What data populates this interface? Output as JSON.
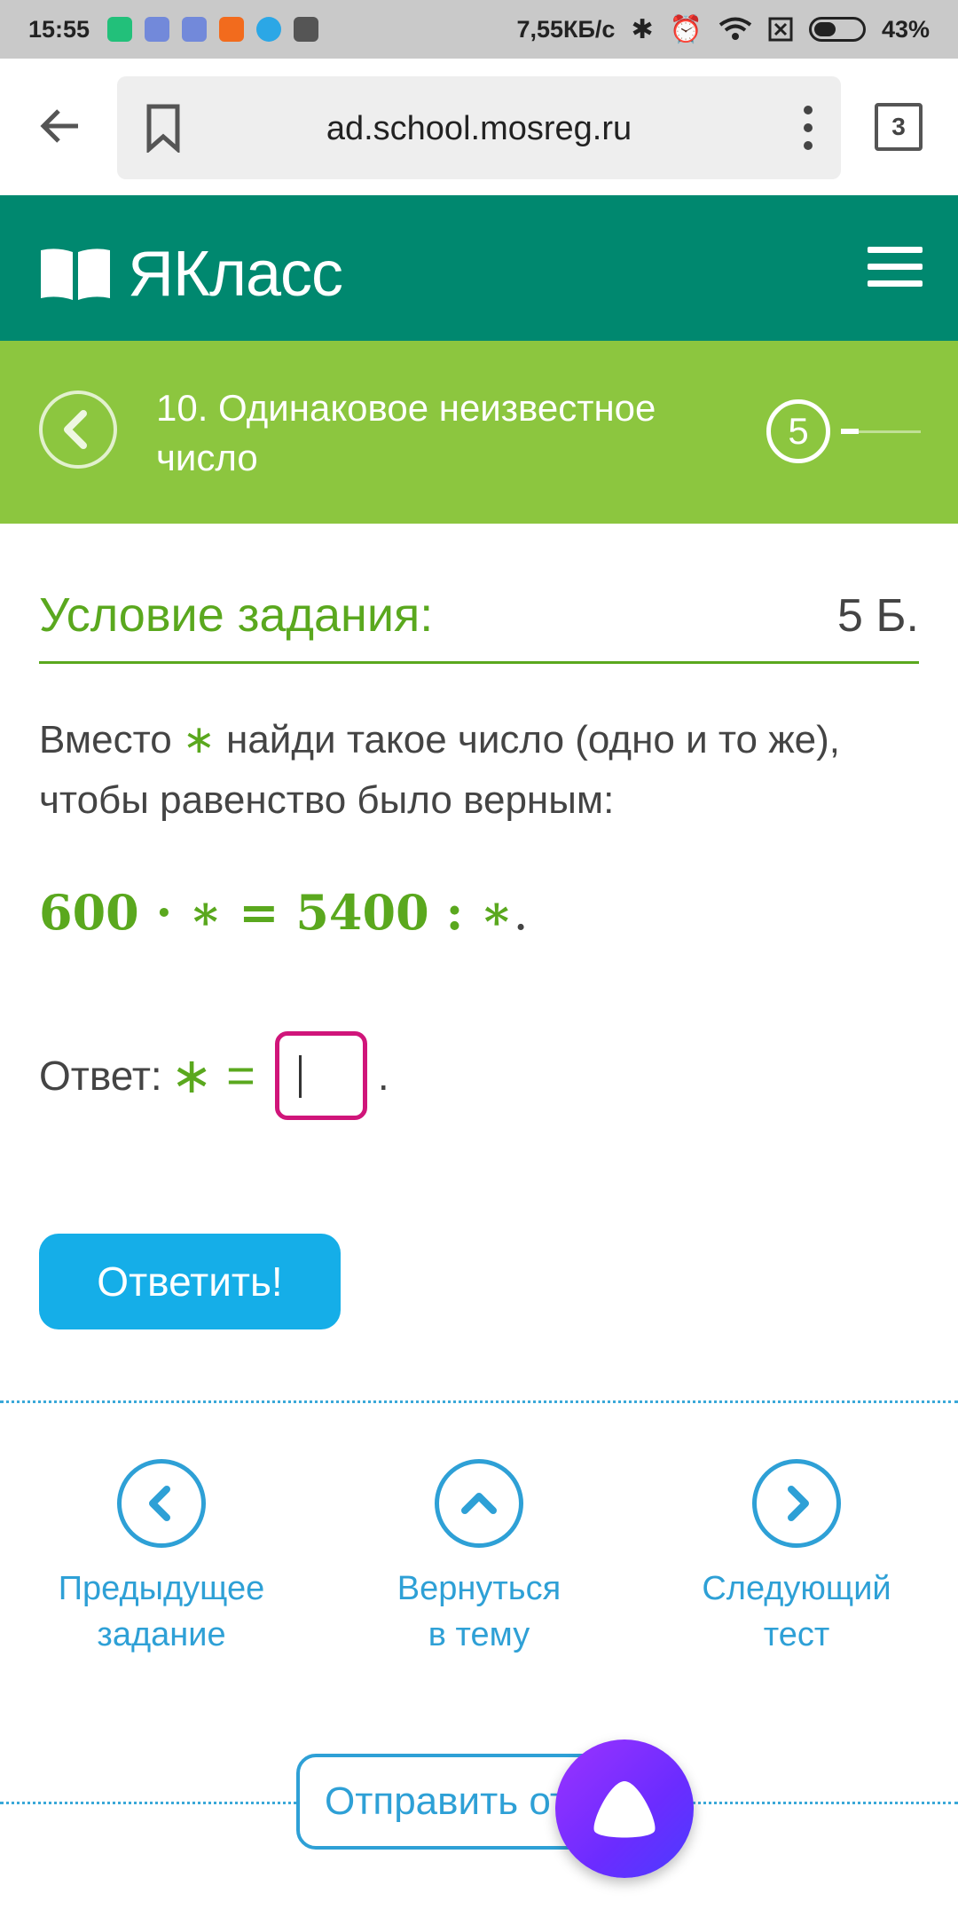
{
  "status_bar": {
    "time": "15:55",
    "network_speed": "7,55КБ/с",
    "battery": "43%",
    "battery_level": 0.43
  },
  "browser": {
    "url": "ad.school.mosreg.ru",
    "tab_count": "3"
  },
  "header": {
    "logo_text": "ЯКласс"
  },
  "topic": {
    "title": "10. Одинаковое неизвестное число",
    "step": "5"
  },
  "task": {
    "heading": "Условие задания:",
    "points": "5 Б.",
    "text_before": "Вместо ",
    "star": "∗",
    "text_after": " найди такое число (одно и то же), чтобы равенство было верным:",
    "equation": {
      "left": "600",
      "op1": "·",
      "star1": "∗",
      "eq": "=",
      "right": "5400",
      "op2": ":",
      "star2": "∗",
      "end": "."
    },
    "answer_label": "Ответ:",
    "answer_symbol": "∗ =",
    "answer_value": "",
    "answer_period": "."
  },
  "actions": {
    "submit_label": "Ответить!",
    "send_label": "Отправить от"
  },
  "nav": {
    "prev_line1": "Предыдущее",
    "prev_line2": "задание",
    "back_line1": "Вернуться",
    "back_line2": "в тему",
    "next_line1": "Следующий",
    "next_line2": "тест"
  },
  "colors": {
    "teal": "#00886f",
    "green_bar": "#8cc63f",
    "green_text": "#5aa81e",
    "blue": "#15aee8",
    "input_border": "#d0157a"
  },
  "icons": [
    "back-arrow-icon",
    "bookmark-icon",
    "more-vert-icon",
    "book-logo-icon",
    "menu-icon",
    "chevron-left-icon",
    "chevron-up-icon",
    "chevron-right-icon",
    "alice-icon",
    "bluetooth-icon",
    "alarm-icon",
    "wifi-icon"
  ]
}
